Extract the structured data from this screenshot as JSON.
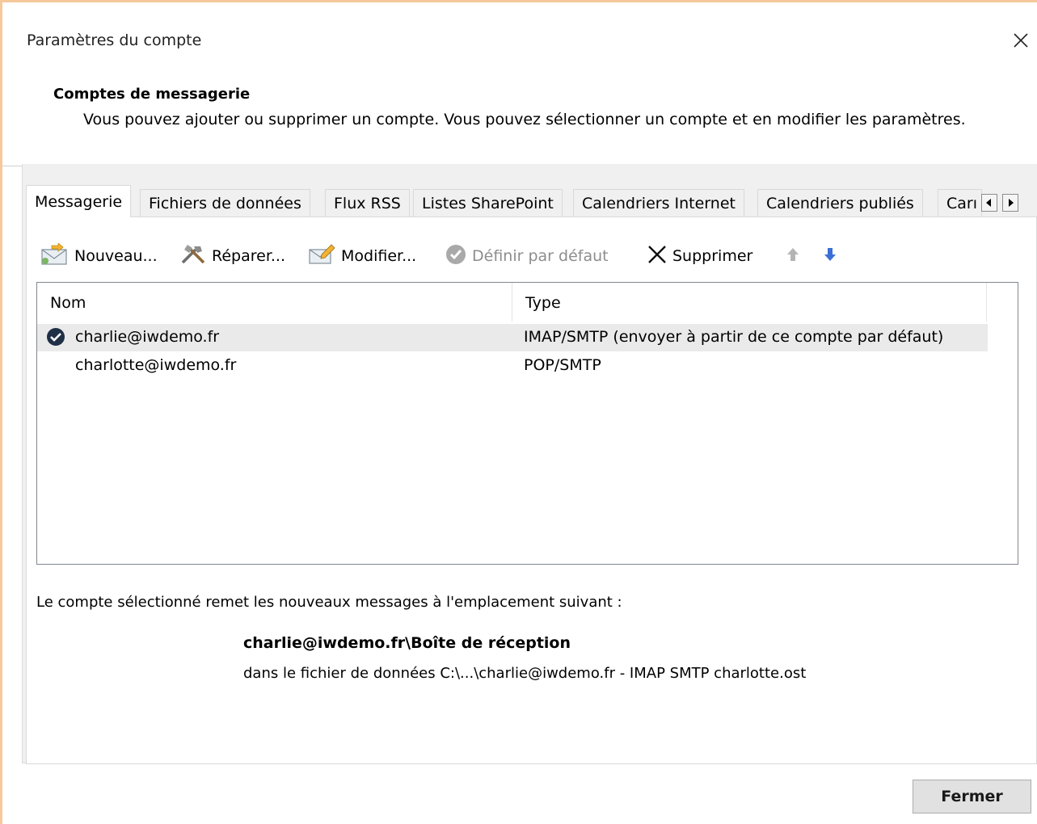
{
  "window": {
    "title": "Paramètres du compte",
    "close_symbol": "✕"
  },
  "header": {
    "heading": "Comptes de messagerie",
    "description": "Vous pouvez ajouter ou supprimer un compte. Vous pouvez sélectionner un compte et en modifier les paramètres."
  },
  "tabs": [
    {
      "label": "Messagerie",
      "active": true
    },
    {
      "label": "Fichiers de données",
      "active": false
    },
    {
      "label": "Flux RSS",
      "active": false
    },
    {
      "label": "Listes SharePoint",
      "active": false
    },
    {
      "label": "Calendriers Internet",
      "active": false
    },
    {
      "label": "Calendriers publiés",
      "active": false
    },
    {
      "label": "Carı",
      "active": false
    }
  ],
  "tab_scroll": {
    "left_icon": "scroll-left-arrow",
    "right_icon": "scroll-right-arrow"
  },
  "toolbar": {
    "new_label": "Nouveau...",
    "repair_label": "Réparer...",
    "modify_label": "Modifier...",
    "default_label": "Définir par défaut",
    "delete_label": "Supprimer",
    "icons": [
      "new-mail-icon",
      "repair-tools-icon",
      "modify-icon",
      "default-check-icon",
      "delete-x-icon",
      "move-up-arrow-icon",
      "move-down-arrow-icon"
    ],
    "colors": {
      "disabled_text": "#8d8d8d",
      "down_arrow": "#3b6fd6",
      "up_arrow": "#a8a8a8"
    }
  },
  "accounts_table": {
    "columns": [
      "Nom",
      "Type"
    ],
    "rows": [
      {
        "name": "charlie@iwdemo.fr",
        "type": "IMAP/SMTP (envoyer à partir de ce compte par défaut)",
        "default": true,
        "selected": true
      },
      {
        "name": "charlotte@iwdemo.fr",
        "type": "POP/SMTP",
        "default": false,
        "selected": false
      }
    ]
  },
  "delivery": {
    "intro": "Le compte sélectionné remet les nouveaux messages à l'emplacement suivant :",
    "location": "charlie@iwdemo.fr\\Boîte de réception",
    "data_file": "dans le fichier de données C:\\...\\charlie@iwdemo.fr - IMAP SMTP charlotte.ost"
  },
  "footer": {
    "close_button": "Fermer"
  },
  "colors": {
    "window_border": "#f5c99b",
    "panel_bg": "#f0f0f0",
    "selected_row": "#eaeaea"
  }
}
